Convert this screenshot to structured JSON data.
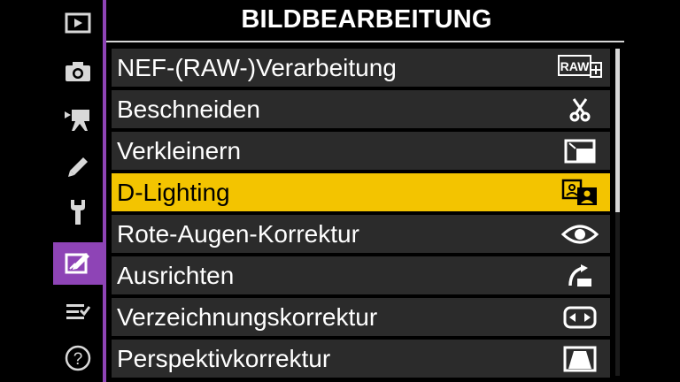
{
  "sidebar": {
    "items": [
      {
        "icon": "playback-icon"
      },
      {
        "icon": "camera-icon"
      },
      {
        "icon": "movie-camera-icon"
      },
      {
        "icon": "pencil-icon"
      },
      {
        "icon": "wrench-icon"
      },
      {
        "icon": "retouch-icon",
        "active": true
      },
      {
        "icon": "my-menu-icon"
      },
      {
        "icon": "help-icon",
        "label": "?"
      }
    ]
  },
  "header": {
    "title": "BILDBEARBEITUNG"
  },
  "menu": {
    "items": [
      {
        "label": "NEF-(RAW-)Verarbeitung",
        "icon": "raw-processing-icon",
        "icon_text": "RAW"
      },
      {
        "label": "Beschneiden",
        "icon": "scissors-icon"
      },
      {
        "label": "Verkleinern",
        "icon": "resize-icon"
      },
      {
        "label": "D-Lighting",
        "icon": "d-lighting-icon",
        "selected": true
      },
      {
        "label": "Rote-Augen-Korrektur",
        "icon": "eye-icon"
      },
      {
        "label": "Ausrichten",
        "icon": "straighten-icon"
      },
      {
        "label": "Verzeichnungskorrektur",
        "icon": "distortion-icon"
      },
      {
        "label": "Perspektivkorrektur",
        "icon": "perspective-icon"
      }
    ]
  },
  "colors": {
    "accent": "#8e44b6",
    "highlight": "#f3c400",
    "row_bg": "#2b2b2b"
  }
}
